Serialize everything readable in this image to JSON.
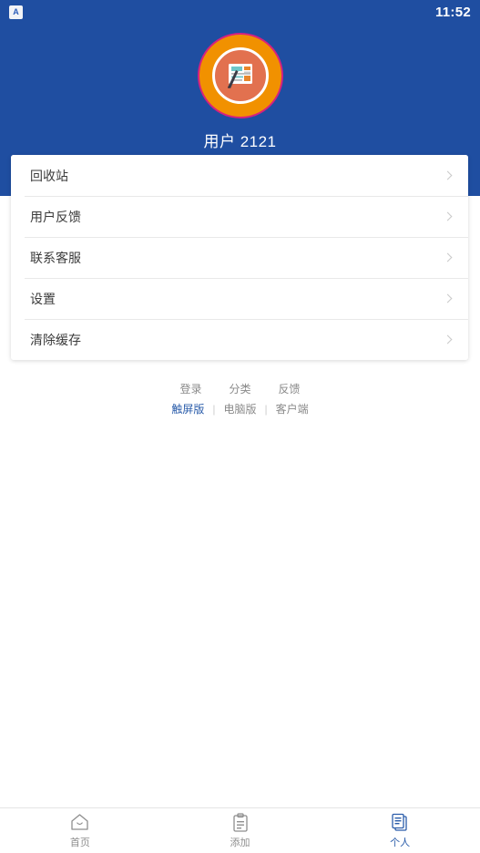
{
  "statusbar": {
    "app_badge_letter": "A",
    "time": "11:52"
  },
  "profile": {
    "avatar_icon": "document-pen-icon",
    "username": "用户 2121"
  },
  "menu": {
    "items": [
      {
        "label": "回收站",
        "icon": "chevron-right-icon"
      },
      {
        "label": "用户反馈",
        "icon": "chevron-right-icon"
      },
      {
        "label": "联系客服",
        "icon": "chevron-right-icon"
      },
      {
        "label": "设置",
        "icon": "chevron-right-icon"
      },
      {
        "label": "清除缓存",
        "icon": "chevron-right-icon"
      }
    ]
  },
  "footer": {
    "top_links": [
      "登录",
      "分类",
      "反馈"
    ],
    "bottom_links": [
      {
        "label": "触屏版",
        "active": true
      },
      {
        "label": "电脑版",
        "active": false
      },
      {
        "label": "客户端",
        "active": false
      }
    ],
    "separator": "|"
  },
  "tabbar": {
    "tabs": [
      {
        "label": "首页",
        "icon": "home-icon",
        "active": false
      },
      {
        "label": "添加",
        "icon": "clipboard-icon",
        "active": false
      },
      {
        "label": "个人",
        "icon": "documents-stack-icon",
        "active": true
      }
    ]
  },
  "colors": {
    "header_blue": "#1f4ea1",
    "accent_blue": "#2a5caa",
    "avatar_orange": "#f19100",
    "avatar_ring_pink": "#d6217f",
    "avatar_inner": "#e2714f",
    "text_dark": "#3b3b3b",
    "text_muted": "#8a8a8a"
  }
}
